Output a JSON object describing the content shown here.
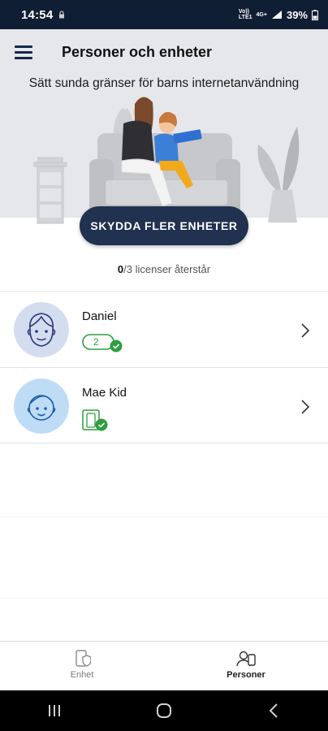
{
  "status_bar": {
    "time": "14:54",
    "network_label_top": "Vo))",
    "network_label_bottom": "LTE1",
    "network2": "4G+",
    "battery": "39%"
  },
  "header": {
    "title": "Personer och enheter",
    "menu_icon": "hamburger-menu-icon"
  },
  "hero": {
    "subtitle": "Sätt sunda gränser för barns internetanvändning",
    "cta_label": "SKYDDA FLER ENHETER"
  },
  "licenses": {
    "used": "0",
    "rest": "/3 licenser återstår"
  },
  "people": [
    {
      "name": "Daniel",
      "device_count": "2",
      "badge_icon": "device-count-check-icon",
      "avatar_icon": "adult-avatar-icon"
    },
    {
      "name": "Mae Kid",
      "device_count": "",
      "badge_icon": "phone-tablet-check-icon",
      "avatar_icon": "child-avatar-icon"
    }
  ],
  "bottom_nav": {
    "tabs": [
      {
        "label": "Enhet",
        "icon": "device-shield-icon",
        "active": false
      },
      {
        "label": "Personer",
        "icon": "people-icon",
        "active": true
      }
    ]
  },
  "system_nav": {
    "recents_icon": "recents-icon",
    "home_icon": "home-icon",
    "back_icon": "back-icon"
  },
  "colors": {
    "primary_navy": "#20324f",
    "status_bar": "#0f1e33",
    "hero_bg": "#e6e7ea",
    "success_green": "#2e9e3f",
    "avatar_adult_bg": "#d4dcef",
    "avatar_child_bg": "#bfdcf7"
  }
}
